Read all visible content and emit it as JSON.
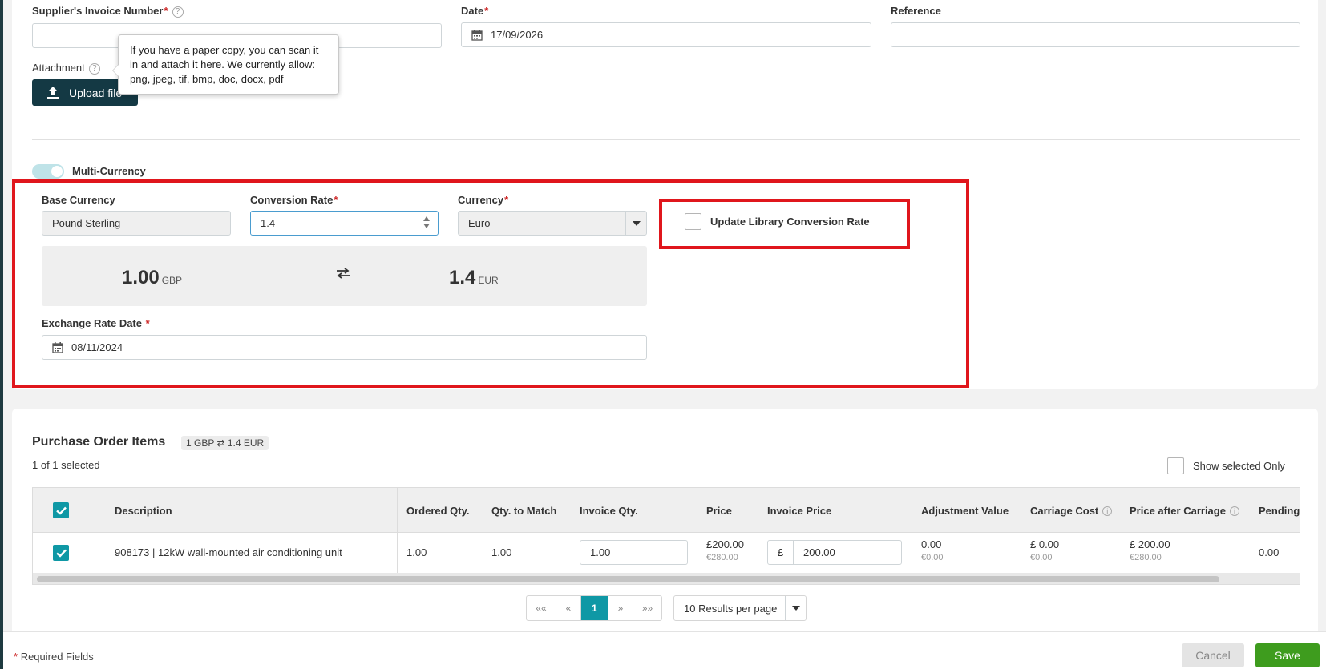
{
  "invoice": {
    "supplier_invoice_number_label": "Supplier's Invoice Number",
    "supplier_invoice_number_value": "",
    "date_label": "Date",
    "date_value": "17/09/2026",
    "reference_label": "Reference",
    "reference_value": "",
    "attachment_label": "Attachment",
    "upload_button_label": "Upload file",
    "tooltip_text": "If you have a paper copy, you can scan it in and attach it here. We currently allow: png, jpeg, tif, bmp, doc, docx, pdf",
    "help_icon": "?",
    "required_marker": "*"
  },
  "currency": {
    "multi_currency_label": "Multi-Currency",
    "multi_currency_enabled": true,
    "base_currency_label": "Base Currency",
    "base_currency_value": "Pound Sterling",
    "conversion_rate_label": "Conversion Rate",
    "conversion_rate_value": "1.4",
    "currency_label": "Currency",
    "currency_value": "Euro",
    "update_library_label": "Update Library Conversion Rate",
    "update_library_checked": false,
    "base_amount": "1.00",
    "base_code": "GBP",
    "converted_amount": "1.4",
    "converted_code": "EUR",
    "exchange_rate_date_label": "Exchange Rate Date",
    "exchange_rate_date_value": "08/11/2024",
    "highlight_color": "#e0161c"
  },
  "purchase_order": {
    "title": "Purchase Order Items",
    "rate_pill": "1 GBP ⇄ 1.4 EUR",
    "selection_count": "1 of 1 selected",
    "show_selected_only_label": "Show selected Only",
    "columns": {
      "description": "Description",
      "ordered_qty": "Ordered Qty.",
      "qty_to_match": "Qty. to Match",
      "invoice_qty": "Invoice Qty.",
      "price": "Price",
      "invoice_price": "Invoice Price",
      "adjustment_value": "Adjustment Value",
      "carriage_cost": "Carriage Cost",
      "price_after_carriage": "Price after Carriage",
      "pending": "Pending"
    },
    "rows": [
      {
        "selected": true,
        "description": "908173 | 12kW wall-mounted air conditioning unit",
        "ordered_qty": "1.00",
        "qty_to_match": "1.00",
        "invoice_qty": "1.00",
        "price": "£200.00",
        "price_converted": "€280.00",
        "invoice_price_symbol": "£",
        "invoice_price": "200.00",
        "adjustment_value": "0.00",
        "adjustment_converted": "€0.00",
        "carriage_cost": "£ 0.00",
        "carriage_converted": "€0.00",
        "price_after_carriage": "£ 200.00",
        "price_after_carriage_converted": "€280.00",
        "pending": "0.00"
      }
    ]
  },
  "pagination": {
    "first": "««",
    "prev": "«",
    "current": "1",
    "next": "»",
    "last": "»»",
    "per_page": "10 Results per page"
  },
  "footer": {
    "required_note": "Required Fields",
    "required_marker": "*",
    "cancel_label": "Cancel",
    "save_label": "Save"
  },
  "colors": {
    "accent_teal": "#0f98a5",
    "primary_dark": "#143944",
    "save_green": "#3e9c1e"
  }
}
